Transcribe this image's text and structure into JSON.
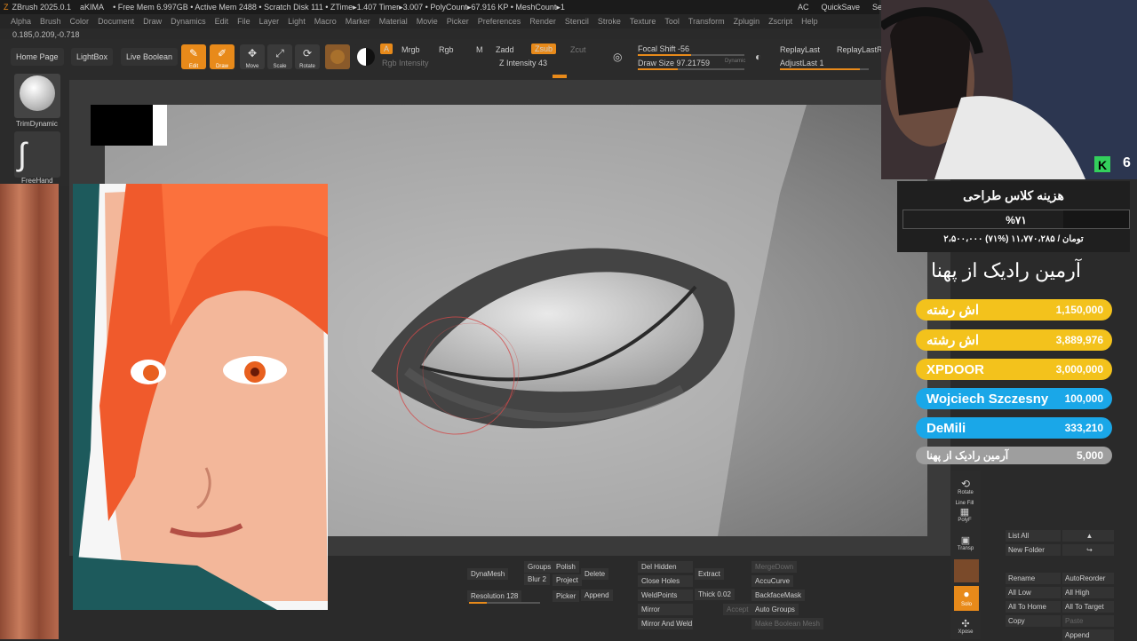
{
  "titlebar": {
    "app": "ZBrush 2025.0.1",
    "doc": "aKIMA",
    "stats": "• Free Mem 6.997GB • Active Mem 2488 • Scratch Disk 111 • ZTime▸1.407 Timer▸3.007 • PolyCount▸67.916 KP • MeshCount▸1",
    "ac": "AC",
    "quicksave": "QuickSave",
    "see": "See"
  },
  "menu": [
    "Alpha",
    "Brush",
    "Color",
    "Document",
    "Draw",
    "Dynamics",
    "Edit",
    "File",
    "Layer",
    "Light",
    "Macro",
    "Marker",
    "Material",
    "Movie",
    "Picker",
    "Preferences",
    "Render",
    "Stencil",
    "Stroke",
    "Texture",
    "Tool",
    "Transform",
    "Zplugin",
    "Zscript",
    "Help"
  ],
  "coords": "0.185,0.209,-0.718",
  "toolbar": {
    "home": "Home Page",
    "lightbox": "LightBox",
    "liveboolean": "Live Boolean",
    "edit": "Edit",
    "draw": "Draw",
    "move": "Move",
    "scale": "Scale",
    "rotate": "Rotate",
    "a": "A",
    "mrgb": "Mrgb",
    "rgb": "Rgb",
    "m": "M",
    "zadd": "Zadd",
    "zsub": "Zsub",
    "zcut": "Zcut",
    "rgb_intensity": "Rgb Intensity",
    "z_intensity": "Z Intensity 43",
    "focal_shift": "Focal Shift -56",
    "draw_size": "Draw Size 97.21759",
    "dynamic": "Dynamic",
    "replay_last": "ReplayLast",
    "replay_last_rel": "ReplayLastRel",
    "adjust_last": "AdjustLast 1"
  },
  "leftpanel": {
    "brush": "TrimDynamic",
    "stroke": "FreeHand"
  },
  "donation": {
    "title": "هزینه کلاس طراحی",
    "percent": "%۷۱",
    "progress": "۲،۵۰۰،۰۰۰ تومان / ۱۱،۷۷۰،۲۸۵ (%۷۱)",
    "progress_fraction": 0.71,
    "supporter": "آرمین رادیک از پهنا"
  },
  "donors": [
    {
      "name": "اش رشته",
      "amount": "1,150,000",
      "color": "#f3c21c"
    },
    {
      "name": "اش رشته",
      "amount": "3,889,976",
      "color": "#f3c21c"
    },
    {
      "name": "XPDOOR",
      "amount": "3,000,000",
      "color": "#f3c21c"
    },
    {
      "name": "Wojciech Szczesny",
      "amount": "100,000",
      "color": "#1aa7e8"
    },
    {
      "name": "DeMili",
      "amount": "333,210",
      "color": "#1aa7e8"
    },
    {
      "name": "آرمین رادیک از پهنا",
      "amount": "5,000",
      "color": "#9e9e9e"
    }
  ],
  "cam": {
    "badge": "6"
  },
  "rightcol": {
    "rotate": "Rotate",
    "linefill": "Line Fill",
    "polyf": "PolyF",
    "transp": "Transp",
    "solo": "Solo",
    "xpose": "Xpose"
  },
  "subtool": {
    "list_all": "List All",
    "new_folder": "New Folder",
    "rename": "Rename",
    "auto_reorder": "AutoReorder",
    "all_low": "All Low",
    "all_high": "All High",
    "all_to_home": "All To Home",
    "all_to_target": "All To Target",
    "copy": "Copy",
    "paste": "Paste",
    "append": "Append"
  },
  "bottom": {
    "dynamesh": "DynaMesh",
    "groups": "Groups",
    "polish": "Polish",
    "blur": "Blur 2",
    "project": "Project",
    "resolution": "Resolution 128",
    "delete": "Delete",
    "append": "Append",
    "picker": "Picker",
    "del_hidden": "Del Hidden",
    "close_holes": "Close Holes",
    "weld_points": "WeldPoints",
    "mirror": "Mirror",
    "mirror_and_weld": "Mirror And Weld",
    "extract": "Extract",
    "thick": "Thick 0.02",
    "accept": "Accept",
    "merge_down": "MergeDown",
    "accucurve": "AccuCurve",
    "backface_mask": "BackfaceMask",
    "auto_groups": "Auto Groups",
    "make_boolean_mesh": "Make Boolean Mesh"
  }
}
